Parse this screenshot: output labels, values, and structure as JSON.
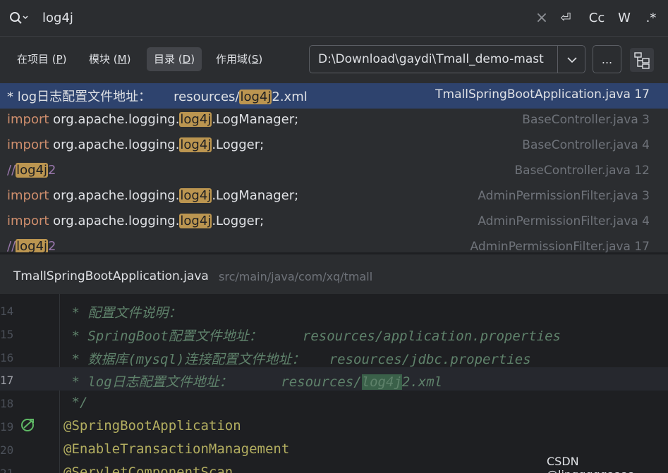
{
  "search": {
    "query": "log4j",
    "options": {
      "clear": "×",
      "newline": "⏎",
      "case": "Cc",
      "words": "W",
      "regex": ".*"
    }
  },
  "scope": {
    "tabs": [
      {
        "label": "在项目 (",
        "mnemonic": "P",
        "suffix": ")"
      },
      {
        "label": "模块 (",
        "mnemonic": "M",
        "suffix": ")"
      },
      {
        "label": "目录 (",
        "mnemonic": "D",
        "suffix": ")"
      },
      {
        "label": "作用域(",
        "mnemonic": "S",
        "suffix": ")"
      }
    ],
    "directory": "D:\\Download\\gaydi\\Tmall_demo-mast",
    "browse": "..."
  },
  "results": [
    {
      "prefix": "* log日志配置文件地址：",
      "mid": "resources/",
      "match": "log4j",
      "suffix": "2.xml",
      "file": "TmallSpringBootApplication.java 17"
    },
    {
      "prefix": "import",
      "mid": " org.apache.logging.",
      "match": "log4j",
      "suffix": ".LogManager;",
      "file": "BaseController.java 3"
    },
    {
      "prefix": "import",
      "mid": " org.apache.logging.",
      "match": "log4j",
      "suffix": ".Logger;",
      "file": "BaseController.java 4"
    },
    {
      "prefix": "//",
      "mid": "",
      "match": "log4j",
      "suffix": "2",
      "file": "BaseController.java 12"
    },
    {
      "prefix": "import",
      "mid": " org.apache.logging.",
      "match": "log4j",
      "suffix": ".LogManager;",
      "file": "AdminPermissionFilter.java 3"
    },
    {
      "prefix": "import",
      "mid": " org.apache.logging.",
      "match": "log4j",
      "suffix": ".Logger;",
      "file": "AdminPermissionFilter.java 4"
    },
    {
      "prefix": "//",
      "mid": "",
      "match": "log4j",
      "suffix": "2",
      "file": "AdminPermissionFilter.java 17"
    }
  ],
  "preview": {
    "file_name": "TmallSpringBootApplication.java",
    "file_path": "src/main/java/com/xq/tmall"
  },
  "editor": {
    "lines": [
      {
        "n": "14",
        "a": " * 配置文件说明：",
        "b": "",
        "c": "",
        "d": ""
      },
      {
        "n": "15",
        "a": " * SpringBoot配置文件地址：",
        "b": "     resources/application.properties",
        "c": "",
        "d": ""
      },
      {
        "n": "16",
        "a": " * 数据库(mysql)连接配置文件地址：",
        "b": "   resources/jdbc.properties",
        "c": "",
        "d": ""
      },
      {
        "n": "17",
        "a": " * log日志配置文件地址：",
        "b": "      resources/",
        "c": "log4j",
        "d": "2.xml"
      },
      {
        "n": "18",
        "a": " */",
        "b": "",
        "c": "",
        "d": ""
      },
      {
        "n": "19",
        "a": "@SpringBootApplication",
        "b": "",
        "c": "",
        "d": ""
      },
      {
        "n": "20",
        "a": "@EnableTransactionManagement",
        "b": "",
        "c": "",
        "d": ""
      },
      {
        "n": "21",
        "a": "@ServletComponentScan",
        "b": "",
        "c": "",
        "d": ""
      }
    ]
  },
  "watermark": "CSDN @lingggggaaaa"
}
